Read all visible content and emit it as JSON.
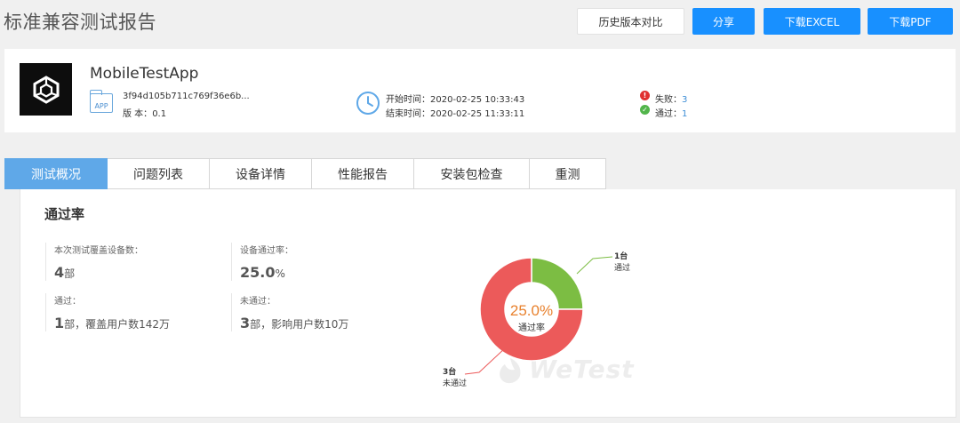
{
  "header": {
    "title": "标准兼容测试报告",
    "buttons": {
      "compare": "历史版本对比",
      "share": "分享",
      "excel": "下载EXCEL",
      "pdf": "下载PDF"
    }
  },
  "app": {
    "name": "MobileTestApp",
    "apk_icon_text": "APP",
    "hash": "3f94d105b711c769f36e6b...",
    "version_label": "版        本：",
    "version": "0.1",
    "start_time": "开始时间：2020-02-25 10:33:43",
    "end_time": "结束时间：2020-02-25 11:33:11",
    "fail_label": "失败：",
    "fail_count": "3",
    "pass_label": "通过：",
    "pass_count": "1"
  },
  "tabs": [
    {
      "label": "测试概况",
      "active": true
    },
    {
      "label": "问题列表"
    },
    {
      "label": "设备详情"
    },
    {
      "label": "性能报告"
    },
    {
      "label": "安装包检查"
    },
    {
      "label": "重测"
    }
  ],
  "overview": {
    "section_title": "通过率",
    "stats": {
      "covered_label": "本次测试覆盖设备数：",
      "covered_value": "4",
      "covered_unit": "部",
      "rate_label": "设备通过率：",
      "rate_value": "25.0",
      "rate_unit": "%",
      "passed_label": "通过：",
      "passed_value": "1",
      "passed_unit": "部，覆盖用户数142万",
      "failed_label": "未通过：",
      "failed_value": "3",
      "failed_unit": "部，影响用户数10万"
    },
    "watermark": "WeTest"
  },
  "chart_data": {
    "type": "pie",
    "donut": true,
    "slices": [
      {
        "label": "通过",
        "count_text": "1台",
        "value": 1,
        "color": "#7cbd43"
      },
      {
        "label": "未通过",
        "count_text": "3台",
        "value": 3,
        "color": "#ec5a5a"
      }
    ],
    "center_value": "25.0%",
    "center_label": "通过率",
    "center_color": "#e8812d"
  }
}
